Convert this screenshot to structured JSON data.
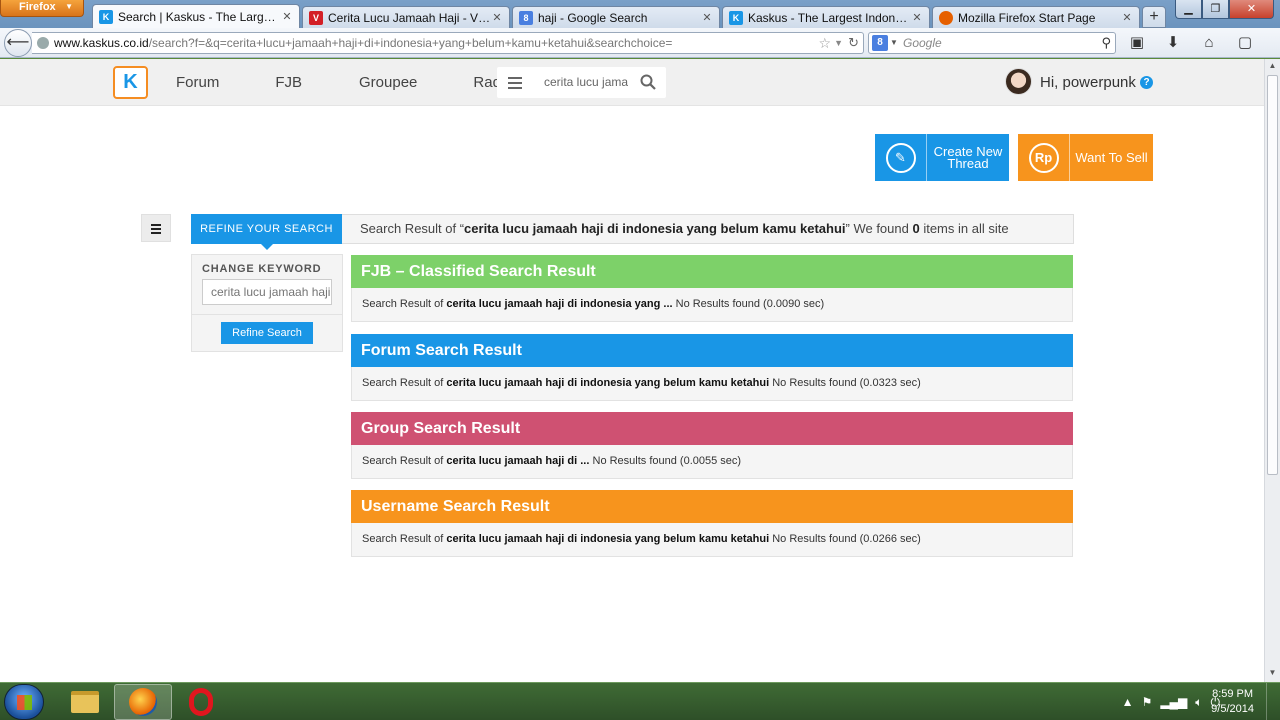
{
  "browser": {
    "app_button": "Firefox",
    "tabs": [
      {
        "label": "Search | Kaskus - The Largest In...",
        "icon": "kaskus-favicon",
        "color": "#1996e6",
        "glyph": "K"
      },
      {
        "label": "Cerita Lucu Jamaah Haji - VIVAf...",
        "icon": "viva-favicon",
        "color": "#d31f26",
        "glyph": "V"
      },
      {
        "label": "haji - Google Search",
        "icon": "google-favicon",
        "color": "#4a7fe0",
        "glyph": "8"
      },
      {
        "label": "Kaskus - The Largest Indonesian...",
        "icon": "kaskus-favicon",
        "color": "#1996e6",
        "glyph": "K"
      },
      {
        "label": "Mozilla Firefox Start Page",
        "icon": "firefox-favicon",
        "color": "#e66000",
        "glyph": "•"
      }
    ],
    "url_host": "www.kaskus.co.id",
    "url_path": "/search?f=&q=cerita+lucu+jamaah+haji+di+indonesia+yang+belum+kamu+ketahui&searchchoice=",
    "search_placeholder": "Google"
  },
  "site": {
    "nav": [
      "Forum",
      "FJB",
      "Groupee",
      "Radio"
    ],
    "search_value": "cerita lucu jamaah haji",
    "user_greeting": "Hi, powerpunk",
    "create_thread": "Create New Thread",
    "create_thread_line1": "Create New",
    "create_thread_line2": "Thread",
    "want_to_sell": "Want To Sell",
    "rp_symbol": "Rp"
  },
  "refine": {
    "header": "REFINE YOUR SEARCH",
    "change_keyword": "CHANGE KEYWORD",
    "keyword_value": "cerita lucu jamaah haji",
    "button": "Refine Search"
  },
  "summary": {
    "prefix": "Search Result of “",
    "query": "cerita lucu jamaah haji di indonesia yang belum kamu ketahui",
    "middle": "” We found ",
    "count": "0",
    "suffix": " items in all site"
  },
  "sections": [
    {
      "title": "FJB – Classified Search Result",
      "color": "#7dd169",
      "prefix": "Search Result of ",
      "query": "cerita lucu jamaah haji di indonesia yang ...",
      "result": " No Results found (0.0090 sec)"
    },
    {
      "title": "Forum Search Result",
      "color": "#1996e6",
      "prefix": "Search Result of ",
      "query": "cerita lucu jamaah haji di indonesia yang belum kamu ketahui",
      "result": " No Results found (0.0323 sec)"
    },
    {
      "title": "Group Search Result",
      "color": "#cf5172",
      "prefix": "Search Result of ",
      "query": "cerita lucu jamaah haji di ...",
      "result": " No Results found (0.0055 sec)"
    },
    {
      "title": "Username Search Result",
      "color": "#f7941d",
      "prefix": "Search Result of ",
      "query": "cerita lucu jamaah haji di indonesia yang belum kamu ketahui",
      "result": " No Results found (0.0266 sec)"
    }
  ],
  "taskbar": {
    "time": "8:59 PM",
    "date": "9/5/2014"
  }
}
